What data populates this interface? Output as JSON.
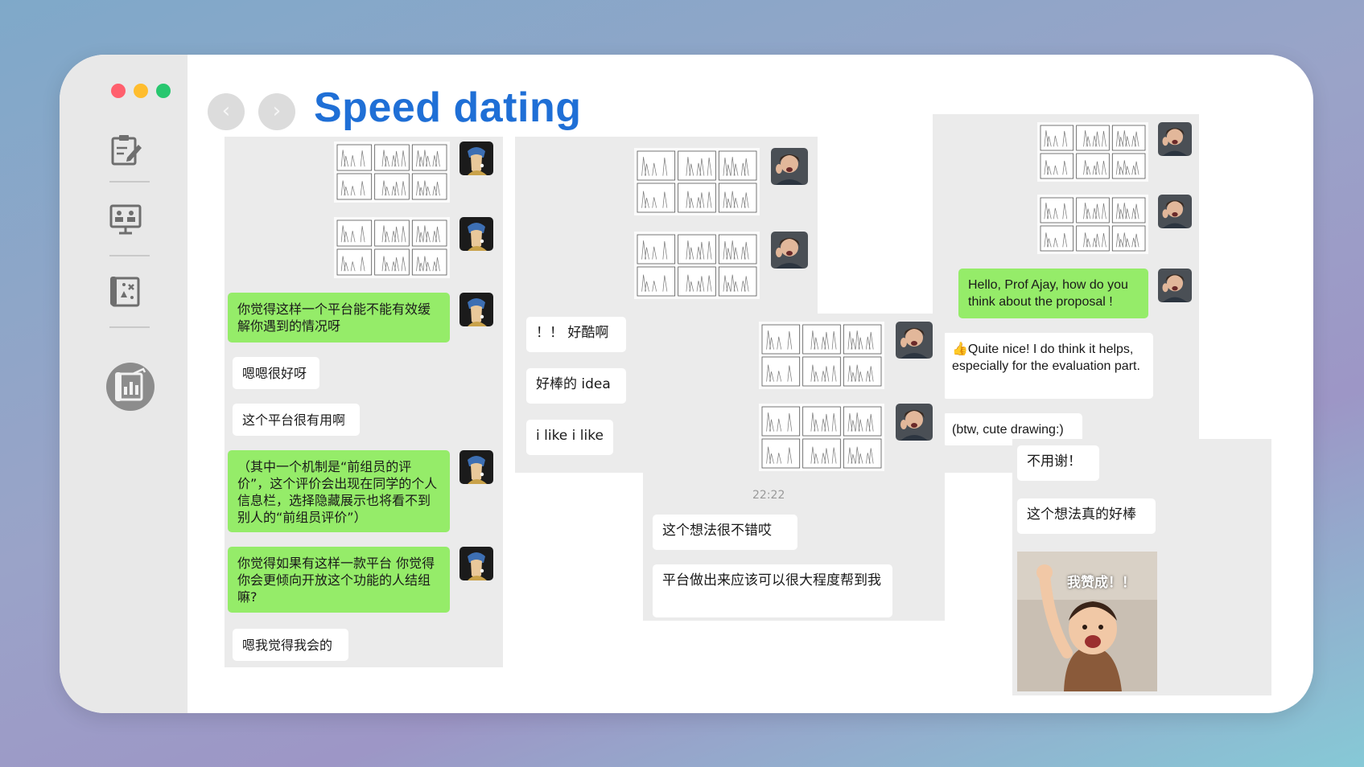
{
  "slide": {
    "title": "Speed dating",
    "nav": {
      "back_glyph": "‹",
      "forward_glyph": "›"
    }
  },
  "sidebar": {
    "traffic_lights": [
      "close",
      "minimize",
      "maximize"
    ],
    "items": [
      {
        "icon": "notes-icon",
        "active": false
      },
      {
        "icon": "presentation-icon",
        "active": false
      },
      {
        "icon": "blueprint-map-icon",
        "active": false
      },
      {
        "icon": "dashboard-chart-icon",
        "active": true
      }
    ]
  },
  "chat1": {
    "messages": [
      {
        "type": "storyboard",
        "side": "out"
      },
      {
        "type": "storyboard",
        "side": "out"
      },
      {
        "type": "text",
        "side": "out",
        "text": "你觉得这样一个平台能不能有效缓解你遇到的情况呀"
      },
      {
        "type": "text",
        "side": "in",
        "text": "嗯嗯很好呀"
      },
      {
        "type": "text",
        "side": "in",
        "text": "这个平台很有用啊"
      },
      {
        "type": "text",
        "side": "out",
        "text": "（其中一个机制是“前组员的评价”，这个评价会出现在同学的个人信息栏，选择隐藏展示也将看不到别人的“前组员评价”）"
      },
      {
        "type": "text",
        "side": "out",
        "text": "你觉得如果有这样一款平台 你觉得你会更倾向开放这个功能的人结组嘛?"
      },
      {
        "type": "text",
        "side": "in",
        "text": "嗯我觉得我会的"
      }
    ]
  },
  "chat2": {
    "messages": [
      {
        "type": "storyboard",
        "side": "out"
      },
      {
        "type": "storyboard",
        "side": "out"
      },
      {
        "type": "text",
        "side": "in",
        "text": "！！ 好酷啊"
      },
      {
        "type": "text",
        "side": "in",
        "text": "好棒的 idea"
      },
      {
        "type": "text",
        "side": "in",
        "text": "i like i like"
      }
    ]
  },
  "chat3": {
    "timestamp": "22:22",
    "messages": [
      {
        "type": "storyboard",
        "side": "out"
      },
      {
        "type": "storyboard",
        "side": "out"
      },
      {
        "type": "text",
        "side": "in",
        "text": "这个想法很不错哎"
      },
      {
        "type": "text",
        "side": "in",
        "text": "平台做出来应该可以很大程度帮到我"
      }
    ]
  },
  "chat4": {
    "messages": [
      {
        "type": "storyboard",
        "side": "out"
      },
      {
        "type": "storyboard",
        "side": "out"
      },
      {
        "type": "text",
        "side": "out",
        "text": "Hello, Prof Ajay, how do you think about the proposal !"
      },
      {
        "type": "text",
        "side": "in",
        "text": "👍Quite nice! I do think it helps, especially for the evaluation part."
      },
      {
        "type": "text",
        "side": "in",
        "text": "(btw, cute drawing:)"
      }
    ]
  },
  "chat5": {
    "messages": [
      {
        "type": "text",
        "side": "in",
        "text": "不用谢！"
      },
      {
        "type": "text",
        "side": "in",
        "text": "这个想法真的好棒"
      },
      {
        "type": "sticker",
        "side": "in",
        "text": "我赞成！！"
      }
    ]
  },
  "colors": {
    "title": "#1f6fd6",
    "outgoing_bubble": "#95ec69",
    "incoming_bubble": "#ffffff",
    "chat_bg": "#ebebeb",
    "sidebar_bg": "#e8e8e8"
  }
}
